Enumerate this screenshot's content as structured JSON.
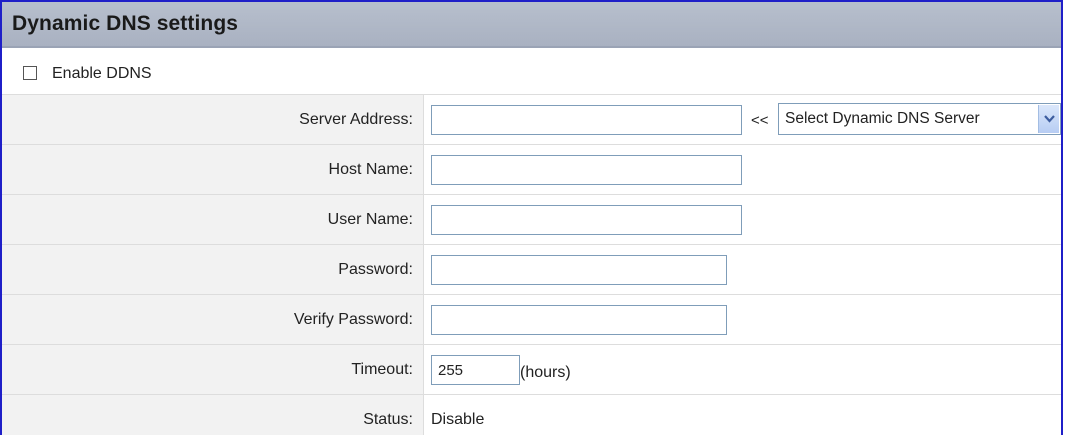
{
  "header": {
    "title": "Dynamic DNS settings"
  },
  "enable": {
    "label": "Enable DDNS",
    "checked": false
  },
  "form": {
    "server_address": {
      "label": "Server Address:",
      "value": "",
      "separator": "<<",
      "select_value": "Select Dynamic DNS Server"
    },
    "host_name": {
      "label": "Host Name:",
      "value": ""
    },
    "user_name": {
      "label": "User Name:",
      "value": ""
    },
    "password": {
      "label": "Password:",
      "value": ""
    },
    "verify_password": {
      "label": "Verify Password:",
      "value": ""
    },
    "timeout": {
      "label": "Timeout:",
      "value": "255",
      "unit": "(hours)"
    },
    "status": {
      "label": "Status:",
      "value": "Disable"
    }
  },
  "icons": {
    "select_arrow": "chevron-down-icon"
  },
  "colors": {
    "frame": "#1f1fc8",
    "header_bg": "#b0b8c8",
    "label_bg": "#f2f2f2",
    "input_border": "#7f9db9"
  }
}
